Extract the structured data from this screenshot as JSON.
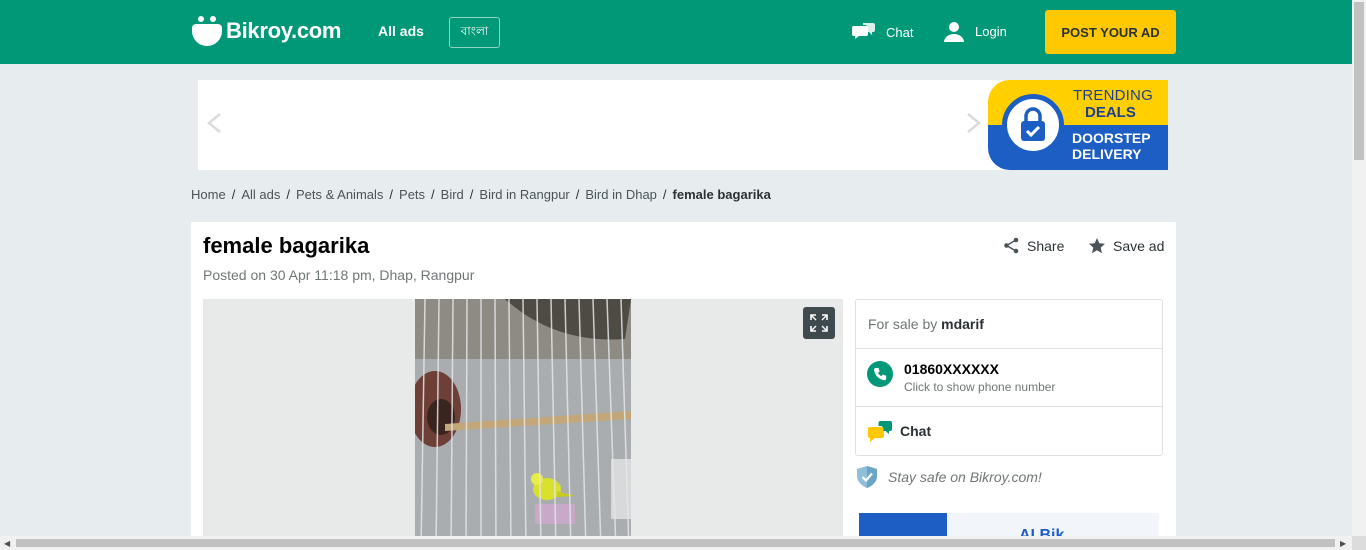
{
  "header": {
    "logo_text": "Bikroy.com",
    "all_ads": "All ads",
    "language": "বাংলা",
    "chat": "Chat",
    "login": "Login",
    "post_ad": "POST YOUR AD"
  },
  "banner": {
    "line1": "TRENDING",
    "line2": "DEALS",
    "line3": "DOORSTEP",
    "line4": "DELIVERY"
  },
  "breadcrumb": [
    "Home",
    "All ads",
    "Pets & Animals",
    "Pets",
    "Bird",
    "Bird in Rangpur",
    "Bird in Dhap",
    "female bagarika"
  ],
  "ad": {
    "title": "female bagarika",
    "posted": "Posted on 30 Apr 11:18 pm, Dhap, Rangpur",
    "share": "Share",
    "save": "Save ad"
  },
  "seller": {
    "prefix": "For sale by",
    "name": "mdarif",
    "phone": "01860XXXXXX",
    "phone_hint": "Click to show phone number",
    "chat": "Chat"
  },
  "safety": "Stay safe on Bikroy.com!",
  "promo_text": "AI Bik",
  "colors": {
    "brand": "#009877",
    "accent": "#ffc800",
    "blue": "#1c5ec4"
  }
}
